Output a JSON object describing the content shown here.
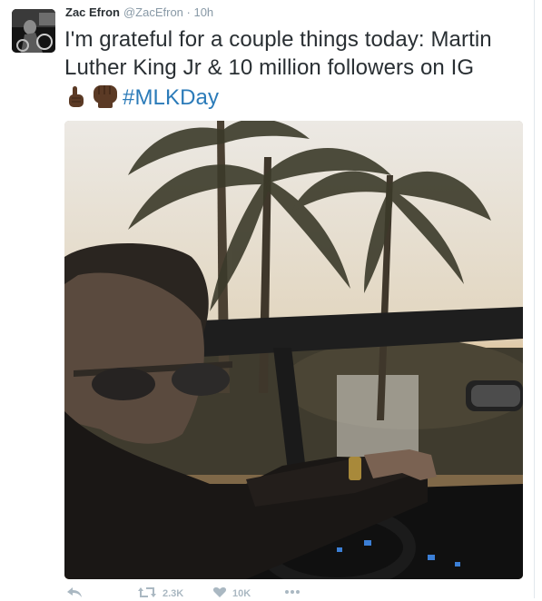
{
  "tweet": {
    "name": "Zac Efron",
    "handle": "@ZacEfron · 10h",
    "text": "I'm grateful for a couple things today: Martin Luther King Jr & 10 million followers on IG",
    "hashtag": "#MLKDay",
    "emojis": [
      "index-pointing-up-emoji",
      "raised-fist-emoji"
    ]
  },
  "actions": {
    "retweet_count": "2.3K",
    "like_count": "10K"
  },
  "colors": {
    "text": "#292f33",
    "muted": "#8899a6",
    "link": "#2b7bb9",
    "action": "#aab8c2"
  }
}
